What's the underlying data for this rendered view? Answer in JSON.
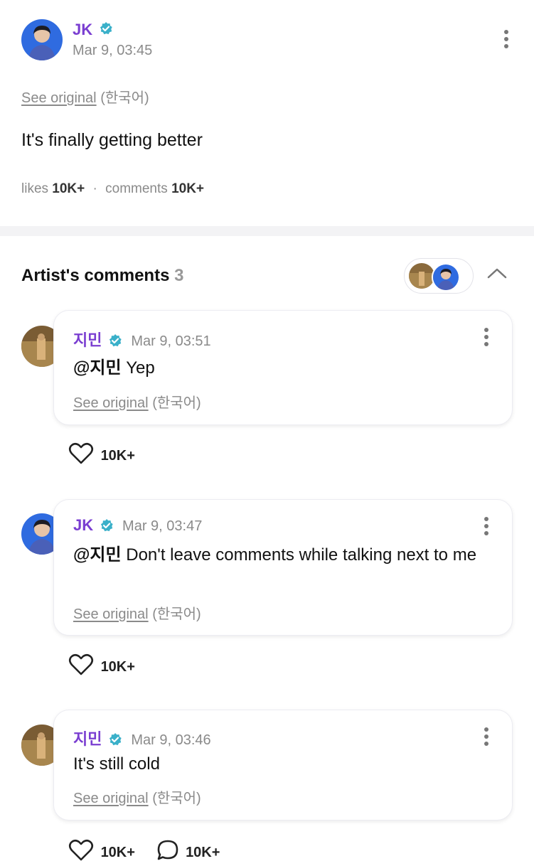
{
  "post": {
    "author": "JK",
    "time": "Mar 9, 03:45",
    "see_original": "See original",
    "language": "(한국어)",
    "text": "It's finally getting better",
    "likes_label": "likes",
    "likes_count": "10K+",
    "separator": "·",
    "comments_label": "comments",
    "comments_count": "10K+"
  },
  "artist_comments": {
    "title": "Artist's comments",
    "count": "3"
  },
  "comments": [
    {
      "author": "지민",
      "time": "Mar 9, 03:51",
      "mention": "@지민",
      "text": " Yep",
      "see_original": "See original",
      "language": "(한국어)",
      "likes": "10K+"
    },
    {
      "author": "JK",
      "time": "Mar 9, 03:47",
      "mention": "@지민",
      "text": " Don't leave comments while talking next to me",
      "see_original": "See original",
      "language": "(한국어)",
      "likes": "10K+"
    },
    {
      "author": "지민",
      "time": "Mar 9, 03:46",
      "text": "It's still cold",
      "see_original": "See original",
      "language": "(한국어)",
      "likes": "10K+",
      "replies": "10K+"
    }
  ],
  "colors": {
    "artist_name": "#7a3ed1",
    "verified_badge": "#3ab0c9",
    "muted_text": "#8a8a8a"
  },
  "icons": [
    "verified-badge-icon",
    "more-options-icon",
    "chevron-up-icon",
    "heart-icon",
    "comment-bubble-icon"
  ]
}
